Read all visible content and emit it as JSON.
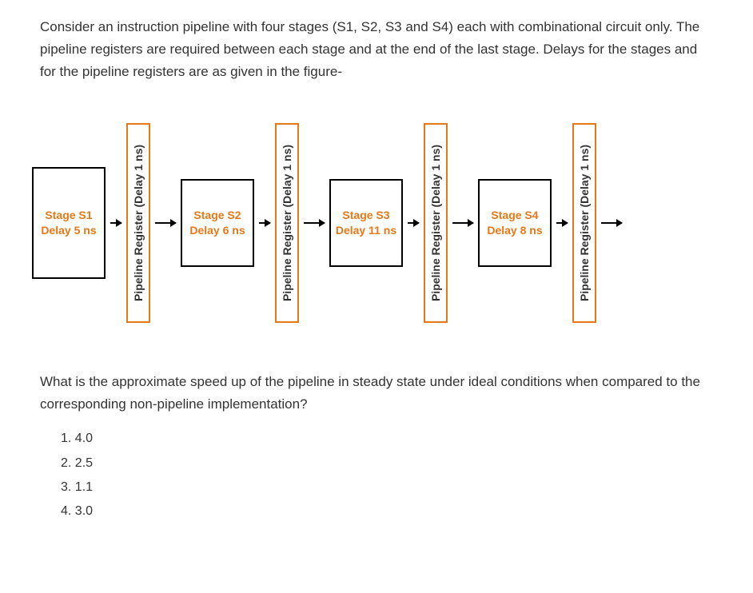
{
  "question": {
    "intro": "Consider an instruction pipeline with four stages (S1, S2, S3 and S4) each with combinational circuit only. The pipeline registers are required between each stage and at the end of the last stage. Delays for the stages and for the pipeline registers are as given in the figure-",
    "followup": "What is the approximate speed up of the pipeline in steady state under ideal conditions when compared to the corresponding non-pipeline implementation?"
  },
  "diagram": {
    "stages": [
      {
        "name": "Stage S1",
        "delay": "Delay 5 ns"
      },
      {
        "name": "Stage S2",
        "delay": "Delay 6 ns"
      },
      {
        "name": "Stage S3",
        "delay": "Delay 11 ns"
      },
      {
        "name": "Stage S4",
        "delay": "Delay 8 ns"
      }
    ],
    "register_label": "Pipeline Register (Delay 1 ns)"
  },
  "options": [
    "1. 4.0",
    "2. 2.5",
    "3. 1.1",
    "4. 3.0"
  ]
}
